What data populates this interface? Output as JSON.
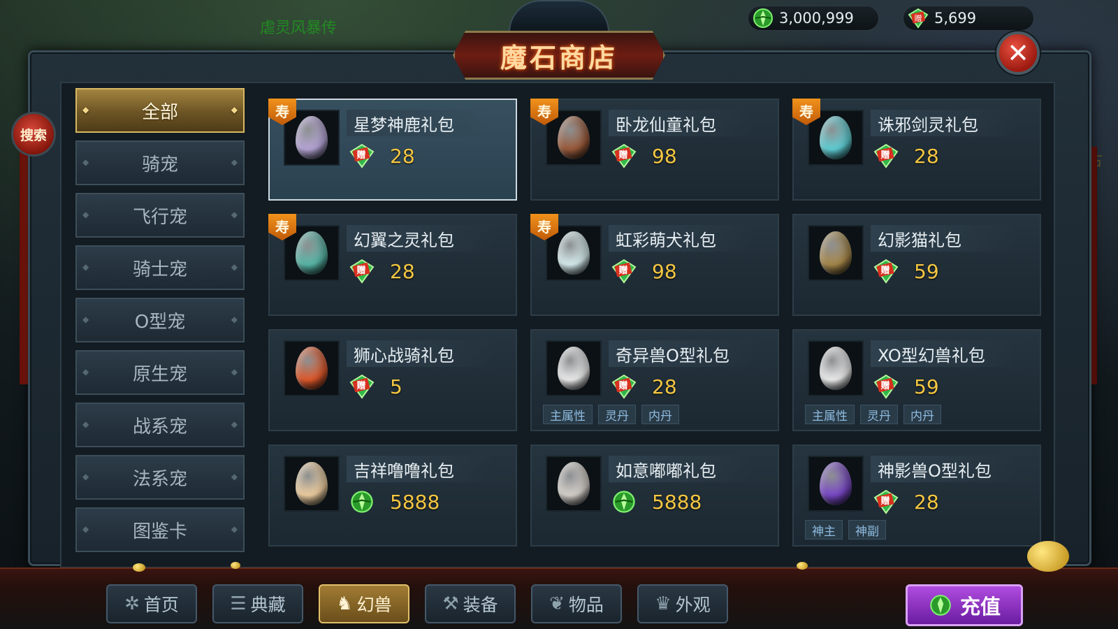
{
  "background": {
    "left_text": "虐灵风暴传",
    "right_text": "古"
  },
  "resources": {
    "gold": "3,000,999",
    "gift_gems": "5,699"
  },
  "title": "魔石商店",
  "search_label": "搜索",
  "categories": [
    {
      "label": "全部",
      "active": true
    },
    {
      "label": "骑宠",
      "active": false
    },
    {
      "label": "飞行宠",
      "active": false
    },
    {
      "label": "骑士宠",
      "active": false
    },
    {
      "label": "O型宠",
      "active": false
    },
    {
      "label": "原生宠",
      "active": false
    },
    {
      "label": "战系宠",
      "active": false
    },
    {
      "label": "法系宠",
      "active": false
    },
    {
      "label": "图鉴卡",
      "active": false
    }
  ],
  "ribbon_char": "寿",
  "gift_badge_char": "赠",
  "items": [
    {
      "name": "星梦神鹿礼包",
      "price": "28",
      "currency": "gift",
      "ribbon": true,
      "selected": true,
      "tags": [],
      "egg": "#b7a6d8"
    },
    {
      "name": "卧龙仙童礼包",
      "price": "98",
      "currency": "gift",
      "ribbon": true,
      "selected": false,
      "tags": [],
      "egg": "#9b5a3a"
    },
    {
      "name": "诛邪剑灵礼包",
      "price": "28",
      "currency": "gift",
      "ribbon": true,
      "selected": false,
      "tags": [],
      "egg": "#5fd0d6"
    },
    {
      "name": "幻翼之灵礼包",
      "price": "28",
      "currency": "gift",
      "ribbon": true,
      "selected": false,
      "tags": [],
      "egg": "#58b8a8"
    },
    {
      "name": "虹彩萌犬礼包",
      "price": "98",
      "currency": "gift",
      "ribbon": true,
      "selected": false,
      "tags": [],
      "egg": "#d8eef0"
    },
    {
      "name": "幻影猫礼包",
      "price": "59",
      "currency": "gift",
      "ribbon": false,
      "selected": false,
      "tags": [],
      "egg": "#a8884a"
    },
    {
      "name": "狮心战骑礼包",
      "price": "5",
      "currency": "gift",
      "ribbon": false,
      "selected": false,
      "tags": [],
      "egg": "#e0582a"
    },
    {
      "name": "奇异兽O型礼包",
      "price": "28",
      "currency": "gift",
      "ribbon": false,
      "selected": false,
      "tags": [
        "主属性",
        "灵丹",
        "内丹"
      ],
      "egg": "#eeeeee"
    },
    {
      "name": "XO型幻兽礼包",
      "price": "59",
      "currency": "gift",
      "ribbon": false,
      "selected": false,
      "tags": [
        "主属性",
        "灵丹",
        "内丹"
      ],
      "egg": "#eeeeee"
    },
    {
      "name": "吉祥噜噜礼包",
      "price": "5888",
      "currency": "gold",
      "ribbon": false,
      "selected": false,
      "tags": [],
      "egg": "#f0cfa0"
    },
    {
      "name": "如意嘟嘟礼包",
      "price": "5888",
      "currency": "gold",
      "ribbon": false,
      "selected": false,
      "tags": [],
      "egg": "#d8d2cc"
    },
    {
      "name": "神影兽O型礼包",
      "price": "28",
      "currency": "gift",
      "ribbon": false,
      "selected": false,
      "tags": [
        "神主",
        "神副"
      ],
      "egg": "#7a48c8"
    }
  ],
  "bottom_nav": [
    {
      "label": "首页",
      "icon": "pinwheel-icon",
      "glyph": "✲",
      "active": false
    },
    {
      "label": "典藏",
      "icon": "collection-icon",
      "glyph": "☰",
      "active": false
    },
    {
      "label": "幻兽",
      "icon": "beast-icon",
      "glyph": "♞",
      "active": true
    },
    {
      "label": "装备",
      "icon": "axe-icon",
      "glyph": "⚒",
      "active": false
    },
    {
      "label": "物品",
      "icon": "item-icon",
      "glyph": "❦",
      "active": false
    },
    {
      "label": "外观",
      "icon": "armor-icon",
      "glyph": "♛",
      "active": false
    }
  ],
  "recharge_label": "充值",
  "colors": {
    "price": "#f5c742",
    "gold_gem": "#3ed63a",
    "gift_gem": "#2fb84a",
    "gift_badge": "#d83020",
    "recharge": "#8c34c8"
  }
}
